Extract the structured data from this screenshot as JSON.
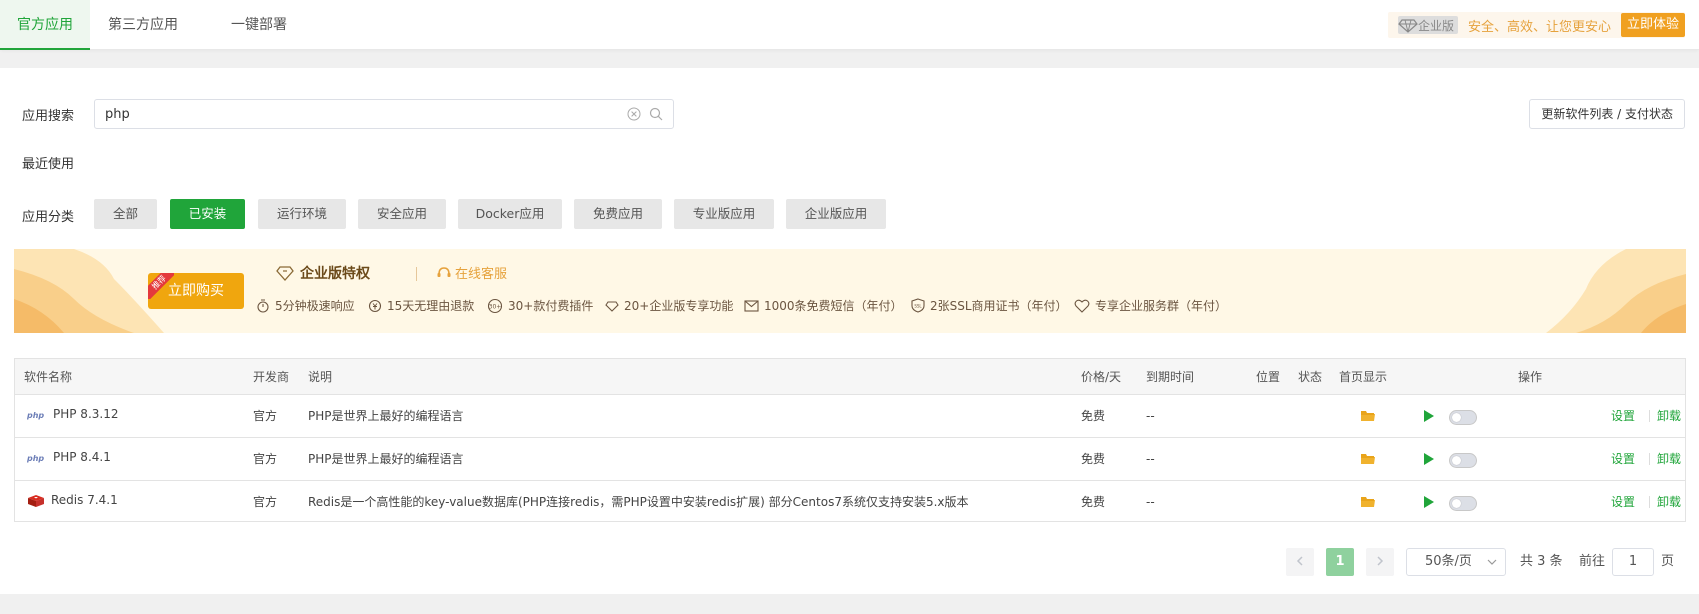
{
  "tabs": [
    {
      "label": "官方应用",
      "active": true
    },
    {
      "label": "第三方应用",
      "active": false
    },
    {
      "label": "一键部署",
      "active": false
    }
  ],
  "promo_top": {
    "badge": "企业版",
    "slogan": "安全、高效、让您更安心",
    "button": "立即体验"
  },
  "search": {
    "label": "应用搜索",
    "value": "php"
  },
  "refresh_button": "更新软件列表 / 支付状态",
  "recent_label": "最近使用",
  "category": {
    "label": "应用分类",
    "items": [
      "全部",
      "已安装",
      "运行环境",
      "安全应用",
      "Docker应用",
      "免费应用",
      "专业版应用",
      "企业版应用"
    ],
    "active_index": 1
  },
  "banner": {
    "buy_button": "立即购买",
    "tag": "推荐",
    "title": "企业版特权",
    "service": "在线客服",
    "features": [
      "5分钟极速响应",
      "15天无理由退款",
      "30+款付费插件",
      "20+企业版专享功能",
      "1000条免费短信（年付）",
      "2张SSL商用证书（年付）",
      "专享企业服务群（年付）"
    ]
  },
  "table": {
    "headers": {
      "name": "软件名称",
      "developer": "开发商",
      "desc": "说明",
      "price": "价格/天",
      "expire": "到期时间",
      "location": "位置",
      "status": "状态",
      "homepage": "首页显示",
      "actions": "操作"
    },
    "rows": [
      {
        "icon": "php-icon",
        "name": "PHP 8.3.12",
        "developer": "官方",
        "desc": "PHP是世界上最好的编程语言",
        "price": "免费",
        "expire": "--",
        "settings": "设置",
        "uninstall": "卸载"
      },
      {
        "icon": "php-icon",
        "name": "PHP 8.4.1",
        "developer": "官方",
        "desc": "PHP是世界上最好的编程语言",
        "price": "免费",
        "expire": "--",
        "settings": "设置",
        "uninstall": "卸载"
      },
      {
        "icon": "redis-icon",
        "name": "Redis 7.4.1",
        "developer": "官方",
        "desc": "Redis是一个高性能的key-value数据库(PHP连接redis，需PHP设置中安装redis扩展) 部分Centos7系统仅支持安装5.x版本",
        "price": "免费",
        "expire": "--",
        "settings": "设置",
        "uninstall": "卸载"
      }
    ]
  },
  "pagination": {
    "current": "1",
    "page_size": "50条/页",
    "total": "共 3 条",
    "goto_prefix": "前往",
    "goto_value": "1",
    "goto_suffix": "页"
  },
  "colors": {
    "accent": "#20a53a",
    "gold": "#f0a60e"
  }
}
